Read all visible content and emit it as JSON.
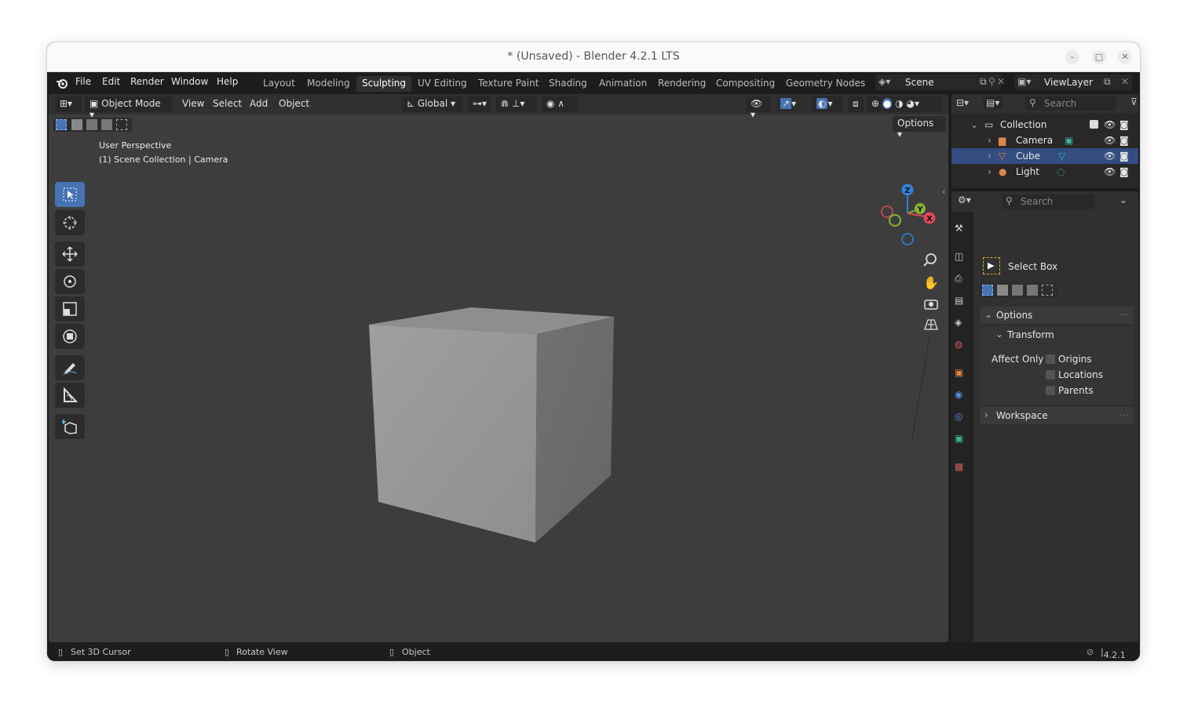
{
  "window": {
    "title": "* (Unsaved) - Blender 4.2.1 LTS"
  },
  "menus": [
    "File",
    "Edit",
    "Render",
    "Window",
    "Help"
  ],
  "workspaces": [
    "Layout",
    "Modeling",
    "Sculpting",
    "UV Editing",
    "Texture Paint",
    "Shading",
    "Animation",
    "Rendering",
    "Compositing",
    "Geometry Nodes"
  ],
  "active_workspace": "Sculpting",
  "scene": {
    "name": "Scene"
  },
  "view_layer": {
    "name": "ViewLayer"
  },
  "viewport": {
    "mode": "Object Mode",
    "menu": [
      "View",
      "Select",
      "Add",
      "Object"
    ],
    "orientation": "Global",
    "options_label": "Options",
    "perspective_label": "User Perspective",
    "collection_label": "(1) Scene Collection | Camera",
    "gizmo": {
      "x": "X",
      "y": "Y",
      "z": "Z"
    }
  },
  "outliner": {
    "search_placeholder": "Search",
    "collection": "Collection",
    "objects": [
      {
        "name": "Camera",
        "selected": false
      },
      {
        "name": "Cube",
        "selected": true
      },
      {
        "name": "Light",
        "selected": false
      }
    ]
  },
  "properties": {
    "search_placeholder": "Search",
    "tool_name": "Select Box",
    "options_panel": "Options",
    "transform_panel": "Transform",
    "affect_only": "Affect Only",
    "checkboxes": [
      "Origins",
      "Locations",
      "Parents"
    ],
    "workspace_panel": "Workspace"
  },
  "statusbar": {
    "left": "Set 3D Cursor",
    "middle": "Rotate View",
    "right": "Object",
    "version": "4.2.1"
  },
  "colors": {
    "accent": "#4772b3",
    "selection": "#334d80",
    "x_axis": "#e0465a",
    "y_axis": "#84b530",
    "z_axis": "#2f83db"
  }
}
